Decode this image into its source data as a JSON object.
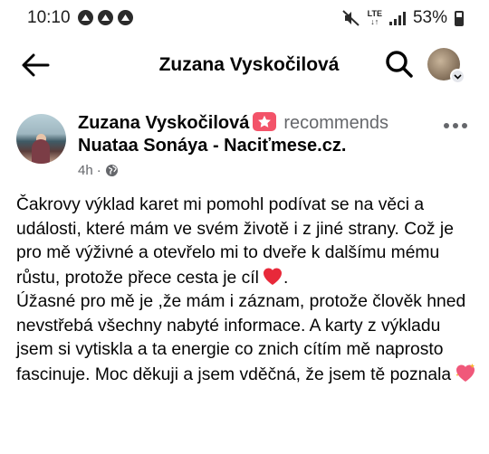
{
  "status_bar": {
    "time": "10:10",
    "network": "LTE",
    "battery": "53%",
    "notification_icons": [
      "alert-icon",
      "alert-icon",
      "alert-icon"
    ]
  },
  "header": {
    "title": "Zuzana Vyskočilová",
    "back_icon": "back-arrow-icon",
    "search_icon": "search-icon",
    "profile_icon": "avatar"
  },
  "post": {
    "author": "Zuzana Vyskočilová",
    "action": "recommends",
    "target": "Nuataa Sonáya - Nacitmese.cz.",
    "target_display": "Nuataa Sonáya - Naciťmese.cz.",
    "time": "4h",
    "separator": "·",
    "privacy_icon": "globe-icon",
    "paragraph1": "Čakrovy výklad karet mi pomohl podívat se na věci a události, které mám ve svém životě i z jiné strany. Což je pro mě výživné a otevřelo mi to dveře k dalšímu mému růstu, protože přece cesta je cíl",
    "paragraph2": "Úžasné pro mě je ,že mám i záznam, protože člověk hned nevstřebá všechny nabyté informace. A karty z výkladu jsem si vytiskla a ta energie co znich cítím mě naprosto fascinuje. Moc děkuji a jsem vděčná, že jsem tě poznala",
    "accent_color": "#f35369"
  }
}
